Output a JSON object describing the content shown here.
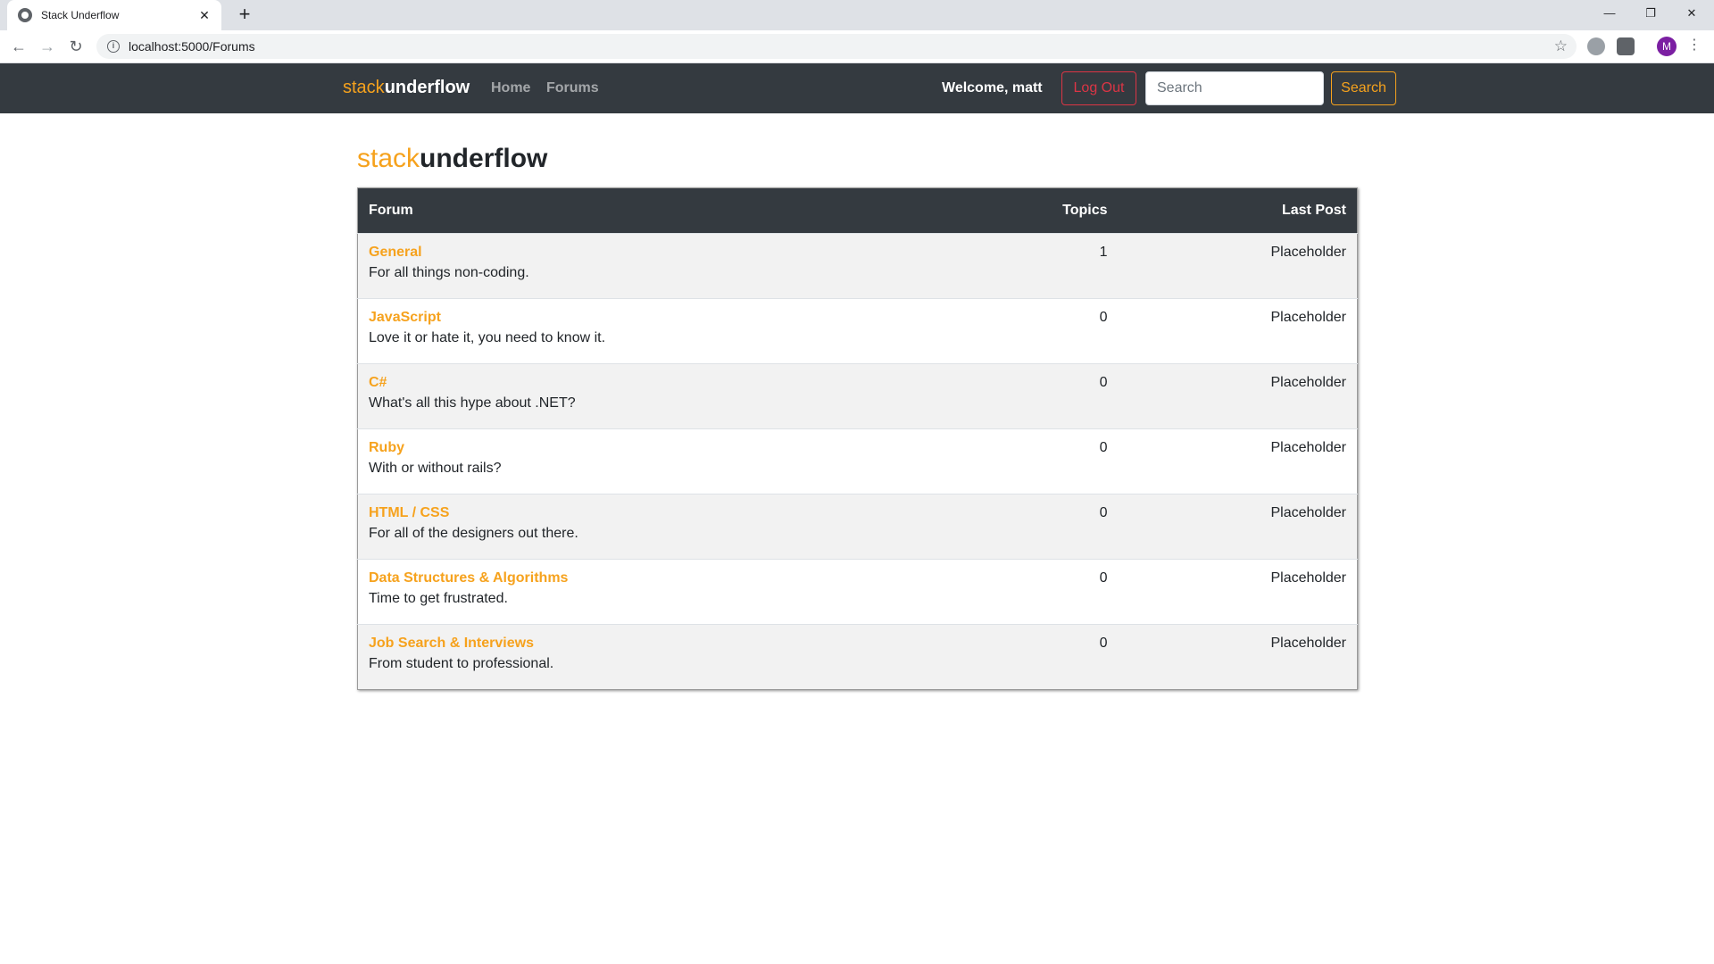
{
  "browser": {
    "tab_title": "Stack Underflow",
    "tab_close": "✕",
    "new_tab": "+",
    "url": "localhost:5000/Forums",
    "window_controls": {
      "minimize": "—",
      "restore": "❐",
      "close": "✕"
    },
    "avatar_letter": "M"
  },
  "navbar": {
    "brand_accent": "stack",
    "brand_main": "underflow",
    "links": [
      "Home",
      "Forums"
    ],
    "welcome": "Welcome, matt",
    "logout_label": "Log Out",
    "search_placeholder": "Search",
    "search_label": "Search"
  },
  "page": {
    "title_accent": "stack",
    "title_main": "underflow"
  },
  "table": {
    "headers": {
      "forum": "Forum",
      "topics": "Topics",
      "last_post": "Last Post"
    },
    "rows": [
      {
        "name": "General",
        "description": "For all things non-coding.",
        "topics": "1",
        "last_post": "Placeholder"
      },
      {
        "name": "JavaScript",
        "description": "Love it or hate it, you need to know it.",
        "topics": "0",
        "last_post": "Placeholder"
      },
      {
        "name": "C#",
        "description": "What's all this hype about .NET?",
        "topics": "0",
        "last_post": "Placeholder"
      },
      {
        "name": "Ruby",
        "description": "With or without rails?",
        "topics": "0",
        "last_post": "Placeholder"
      },
      {
        "name": "HTML / CSS",
        "description": "For all of the designers out there.",
        "topics": "0",
        "last_post": "Placeholder"
      },
      {
        "name": "Data Structures & Algorithms",
        "description": "Time to get frustrated.",
        "topics": "0",
        "last_post": "Placeholder"
      },
      {
        "name": "Job Search & Interviews",
        "description": "From student to professional.",
        "topics": "0",
        "last_post": "Placeholder"
      }
    ]
  },
  "colors": {
    "accent": "#f6a21d",
    "navbar": "#343a40",
    "danger": "#dc3545"
  }
}
